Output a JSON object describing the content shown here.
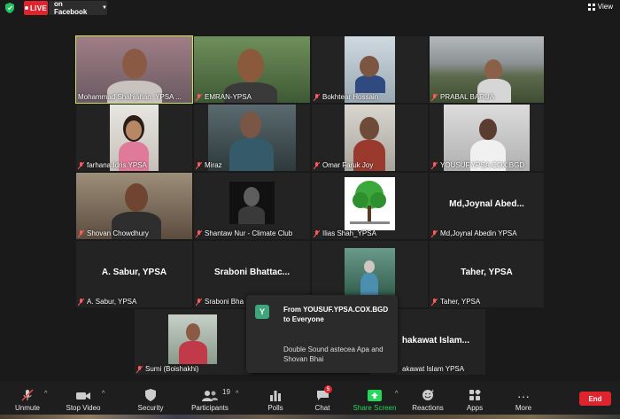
{
  "header": {
    "live_label": "LIVE",
    "platform_label": "on Facebook",
    "view_label": "View"
  },
  "participants": [
    {
      "name": "Mohammad Shahjahan, YPSA ..."
    },
    {
      "name": "EMRAN-YPSA"
    },
    {
      "name": "Bokhtear Hossain"
    },
    {
      "name": "PRABAL BARUA"
    },
    {
      "name": "farhana Idris YPSA"
    },
    {
      "name": "Miraz"
    },
    {
      "name": "Omar Faruk Joy"
    },
    {
      "name": "YOUSUF.YPSA.COX.BGD"
    },
    {
      "name": "Shovan Chowdhury"
    },
    {
      "name": "Shantaw Nur - Climate Club"
    },
    {
      "name": "Ilias Shah_YPSA"
    },
    {
      "name": "Md,Joynal Abedin YPSA",
      "big": "Md,Joynal  Abed..."
    },
    {
      "name": "A. Sabur, YPSA",
      "big": "A. Sabur, YPSA"
    },
    {
      "name": "Sraboni Bha",
      "big": "Sraboni  Bhattac..."
    },
    {
      "name": ""
    },
    {
      "name": "Taher, YPSA",
      "big": "Taher, YPSA"
    },
    {
      "name": "Sumi (Boishakhi)"
    },
    {
      "name": "akawat Islam YPSA",
      "big": "hakawat  Islam..."
    }
  ],
  "notification": {
    "avatar_letter": "Y",
    "from_text": "From YOUSUF.YPSA.COX.BGD to Everyone",
    "message": "Double Sound astecea Apa and Shovan Bhai"
  },
  "toolbar": {
    "unmute": "Unmute",
    "stop_video": "Stop Video",
    "security": "Security",
    "participants": "Participants",
    "participants_count": "19",
    "polls": "Polls",
    "chat": "Chat",
    "chat_badge": "5",
    "share_screen": "Share Screen",
    "reactions": "Reactions",
    "apps": "Apps",
    "more": "More",
    "end": "End"
  },
  "colors": {
    "live_red": "#e0242d",
    "active_speaker": "#c8e65a",
    "share_green": "#23d959",
    "end_red": "#e0242d"
  }
}
